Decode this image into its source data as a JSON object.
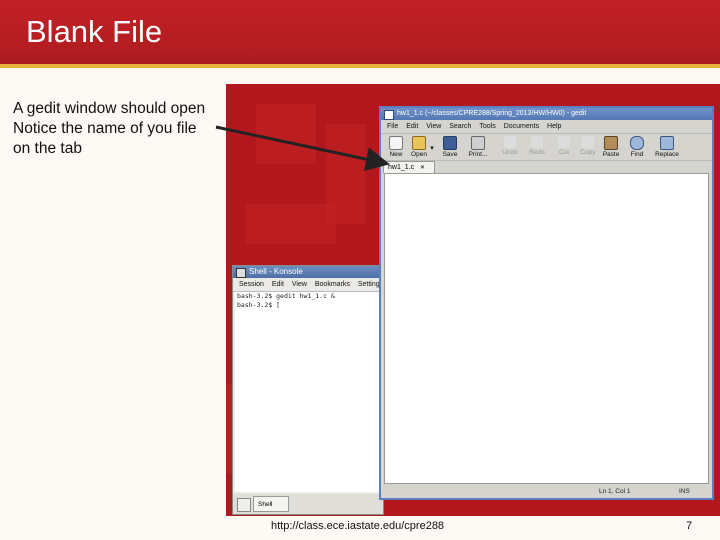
{
  "slide": {
    "title": "Blank File",
    "lines": [
      "A gedit window should open",
      "Notice the name of you file",
      "on the tab"
    ],
    "footer_url": "http://class.ece.iastate.edu/cpre288",
    "page_number": "7"
  },
  "konsole": {
    "title": "Shell - Konsole",
    "menu": [
      "Session",
      "Edit",
      "View",
      "Bookmarks",
      "Settings"
    ],
    "terminal_lines": [
      "bash-3.2$ gedit hw1_1.c &",
      "bash-3.2$ ["
    ],
    "tab_label": "Shell"
  },
  "gedit": {
    "title": "hw1_1.c (~/classes/CPRE288/Spring_2013/HW/HW0) - gedit",
    "menu": [
      "File",
      "Edit",
      "View",
      "Search",
      "Tools",
      "Documents",
      "Help"
    ],
    "toolbar": [
      {
        "label": "New",
        "icon": "new-icon",
        "enabled": true
      },
      {
        "label": "Open",
        "icon": "open-icon",
        "enabled": true
      },
      {
        "label": "Save",
        "icon": "save-icon",
        "enabled": true
      },
      {
        "label": "Print...",
        "icon": "print-icon",
        "enabled": true
      },
      {
        "label": "Undo",
        "icon": "undo-icon",
        "enabled": false
      },
      {
        "label": "Redo",
        "icon": "redo-icon",
        "enabled": false
      },
      {
        "label": "Cut",
        "icon": "cut-icon",
        "enabled": false
      },
      {
        "label": "Copy",
        "icon": "copy-icon",
        "enabled": false
      },
      {
        "label": "Paste",
        "icon": "paste-icon",
        "enabled": true
      },
      {
        "label": "Find",
        "icon": "find-icon",
        "enabled": true
      },
      {
        "label": "Replace",
        "icon": "replace-icon",
        "enabled": true
      }
    ],
    "tab_label": "hw1_1.c",
    "status_position": "Ln 1, Col 1",
    "status_mode": "INS"
  },
  "colors": {
    "title_red": "#b31d22",
    "accent_gold": "#e8b23a",
    "desktop_red": "#b1171c",
    "window_blue": "#5b7fc0"
  }
}
